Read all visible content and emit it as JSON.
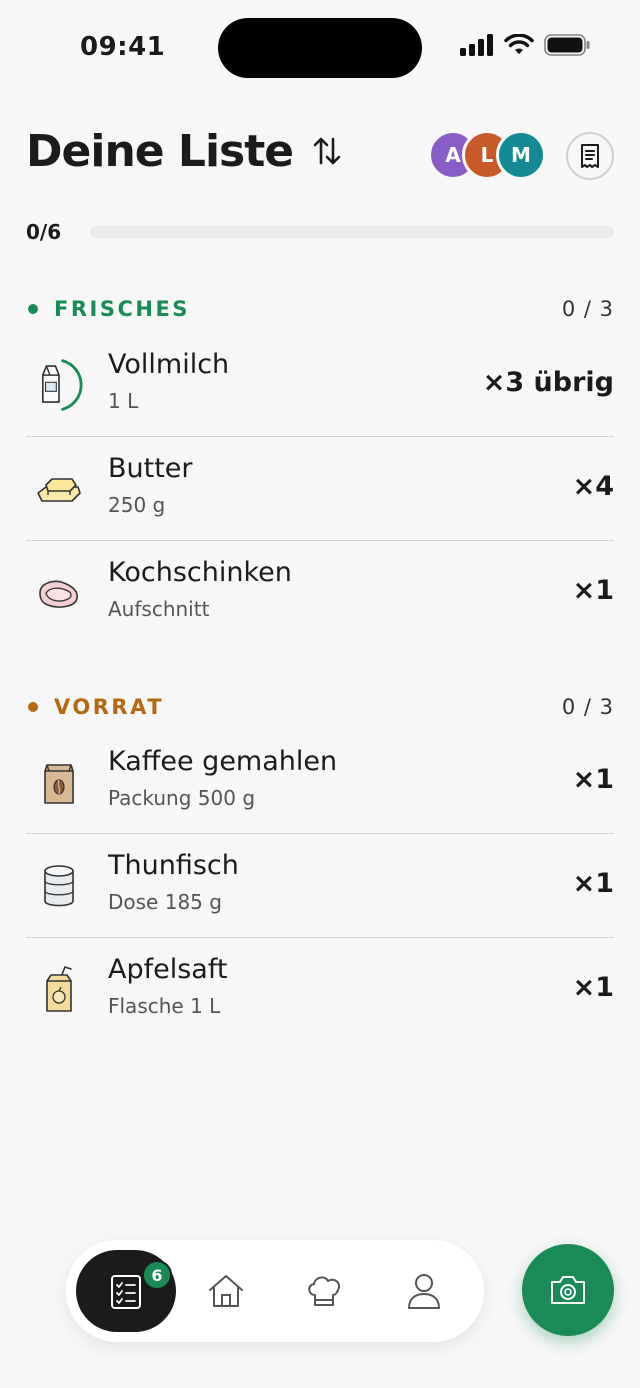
{
  "status_bar": {
    "time": "09:41"
  },
  "header": {
    "title": "Deine Liste",
    "avatars": [
      {
        "initial": "A",
        "color": "#8a5cc7"
      },
      {
        "initial": "L",
        "color": "#c85a2a"
      },
      {
        "initial": "M",
        "color": "#138a95"
      }
    ]
  },
  "progress": {
    "label": "0/6",
    "fraction": 0
  },
  "sections": [
    {
      "title": "FRISCHES",
      "color": "#1a8b57",
      "count": "0 / 3",
      "items": [
        {
          "name": "Vollmilch",
          "sub": "1 L",
          "qty": "×3 übrig",
          "icon": "milk-carton-icon"
        },
        {
          "name": "Butter",
          "sub": "250 g",
          "qty": "×4",
          "icon": "butter-icon"
        },
        {
          "name": "Kochschinken",
          "sub": "Aufschnitt",
          "qty": "×1",
          "icon": "ham-icon"
        }
      ]
    },
    {
      "title": "VORRAT",
      "color": "#b36a12",
      "count": "0 / 3",
      "items": [
        {
          "name": "Kaffee gemahlen",
          "sub": "Packung 500 g",
          "qty": "×1",
          "icon": "coffee-bag-icon"
        },
        {
          "name": "Thunfisch",
          "sub": "Dose 185 g",
          "qty": "×1",
          "icon": "tin-can-icon"
        },
        {
          "name": "Apfelsaft",
          "sub": "Flasche 1 L",
          "qty": "×1",
          "icon": "juice-box-icon"
        }
      ]
    }
  ],
  "bottom_nav": {
    "badge": "6",
    "items": [
      "list-icon",
      "home-icon",
      "chef-hat-icon",
      "profile-icon"
    ]
  }
}
